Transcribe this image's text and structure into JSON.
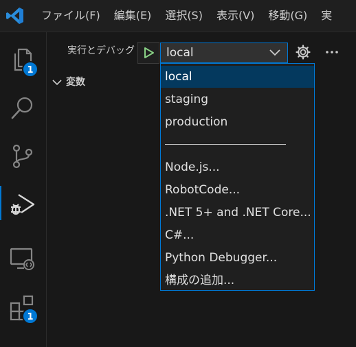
{
  "menu": [
    "ファイル(F)",
    "編集(E)",
    "選択(S)",
    "表示(V)",
    "移動(G)",
    "実"
  ],
  "activity_bar": {
    "explorer_badge": "1",
    "extensions_badge": "1"
  },
  "debug": {
    "title": "実行とデバッグ",
    "selected_config": "local",
    "variables_header": "変数"
  },
  "dropdown": {
    "options": [
      "local",
      "staging",
      "production"
    ],
    "add_options": [
      "Node.js...",
      "RobotCode...",
      ".NET 5+ and .NET Core...",
      "C#...",
      "Python Debugger...",
      "構成の追加..."
    ]
  },
  "colors": {
    "accent": "#0078d4",
    "run_green": "#89d185",
    "selected_bg": "#04395e"
  }
}
